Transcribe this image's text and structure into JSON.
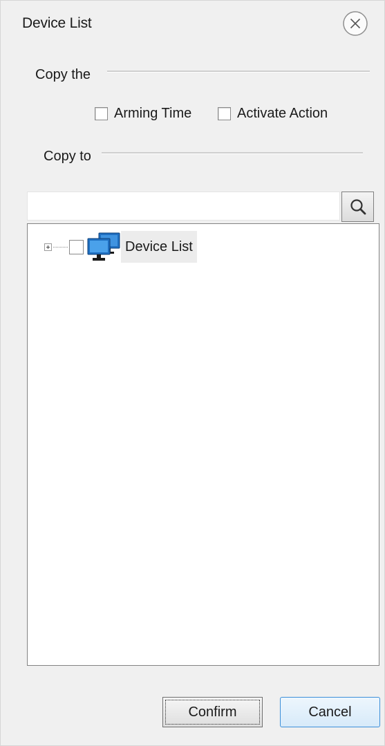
{
  "window": {
    "title": "Device List",
    "close_icon": "close-circle-icon"
  },
  "copy_the": {
    "label": "Copy the",
    "options": [
      {
        "label": "Arming Time",
        "checked": false
      },
      {
        "label": "Activate Action",
        "checked": false
      }
    ]
  },
  "copy_to": {
    "label": "Copy to"
  },
  "search": {
    "value": "",
    "placeholder": "",
    "icon": "search-icon"
  },
  "tree": {
    "root": {
      "label": "Device List",
      "expanded": false,
      "checked": false,
      "icon": "monitors-icon"
    }
  },
  "footer": {
    "confirm_label": "Confirm",
    "cancel_label": "Cancel"
  },
  "colors": {
    "background": "#f0f0f0",
    "accent": "#3c8fd9",
    "icon_blue": "#1f6fc1"
  }
}
